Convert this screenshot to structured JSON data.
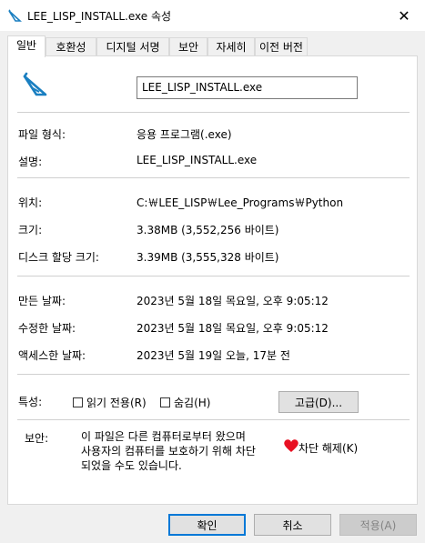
{
  "window": {
    "title": "LEE_LISP_INSTALL.exe 속성",
    "close": "✕"
  },
  "tabs": [
    "일반",
    "호환성",
    "디지털 서명",
    "보안",
    "자세히",
    "이전 버전"
  ],
  "general": {
    "filename": "LEE_LISP_INSTALL.exe",
    "rows": [
      {
        "label": "파일 형식:",
        "value": "응용 프로그램(.exe)"
      },
      {
        "label": "설명:",
        "value": "LEE_LISP_INSTALL.exe"
      },
      {
        "label": "위치:",
        "value": "C:￦LEE_LISP￦Lee_Programs￦Python"
      },
      {
        "label": "크기:",
        "value": "3.38MB (3,552,256 바이트)"
      },
      {
        "label": "디스크 할당 크기:",
        "value": "3.39MB (3,555,328 바이트)"
      },
      {
        "label": "만든 날짜:",
        "value": "2023년 5월 18일 목요일, 오후 9:05:12"
      },
      {
        "label": "수정한 날짜:",
        "value": "2023년 5월 18일 목요일, 오후 9:05:12"
      },
      {
        "label": "액세스한 날짜:",
        "value": "2023년 5월 19일 오늘, 17분 전"
      }
    ],
    "attributes_label": "특성:",
    "readonly_label": "읽기 전용(R)",
    "hidden_label": "숨김(H)",
    "advanced_button": "고급(D)...",
    "security_label": "보안:",
    "security_lines": [
      "이 파일은 다른 컴퓨터로부터 왔으며",
      "사용자의 컴퓨터를 보호하기 위해 차단",
      "되었을 수도 있습니다."
    ],
    "unblock_label": "차단 해제(K)"
  },
  "buttons": {
    "ok": "확인",
    "cancel": "취소",
    "apply": "적용(A)"
  },
  "colors": {
    "accent": "#0078d7",
    "icon_blue": "#1a7fc1",
    "heart": "#e81123"
  }
}
